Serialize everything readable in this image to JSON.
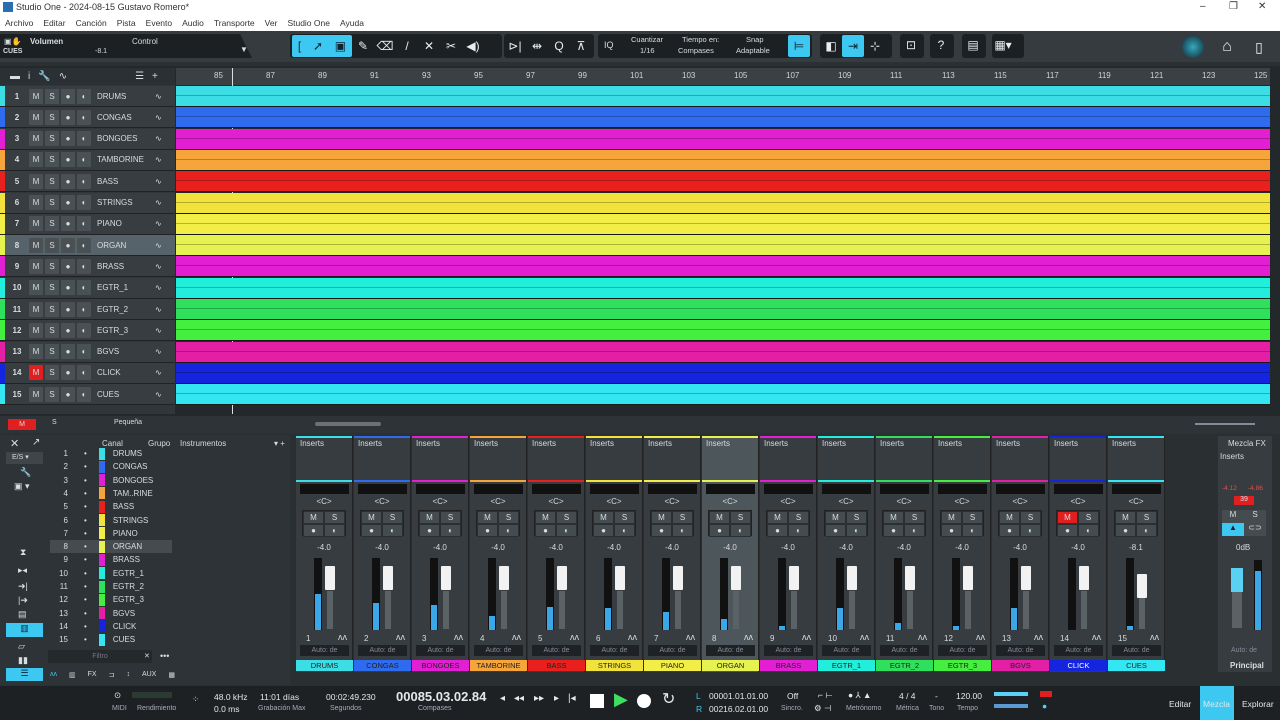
{
  "window": {
    "title": "Studio One - 2024-08-15 Gustavo Romero*",
    "minimize": "–",
    "maximize": "❐",
    "close": "✕"
  },
  "menu": [
    "Archivo",
    "Editar",
    "Canción",
    "Pista",
    "Evento",
    "Audio",
    "Transporte",
    "Ver",
    "Studio One",
    "Ayuda"
  ],
  "control_bar": {
    "param": "Volumen",
    "track": "CUES",
    "value": "-8.1",
    "control_label": "Control"
  },
  "toolbar": {
    "quantize_label": "Cuantizar",
    "quantize_value": "1/16",
    "timebase_label": "Tiempo en:",
    "timebase_value": "Compases",
    "snap_label": "Snap",
    "snap_value": "Adaptable",
    "iq": "IQ",
    "help": "?"
  },
  "ruler": [
    "85",
    "87",
    "89",
    "91",
    "93",
    "95",
    "97",
    "99",
    "101",
    "103",
    "105",
    "107",
    "109",
    "111",
    "113",
    "115",
    "117",
    "119",
    "121",
    "123",
    "125"
  ],
  "tracks": [
    {
      "n": "1",
      "name": "DRUMS",
      "color": "#3ddde6",
      "mute": false
    },
    {
      "n": "2",
      "name": "CONGAS",
      "color": "#2f6bef",
      "mute": false
    },
    {
      "n": "3",
      "name": "BONGOES",
      "color": "#e21fd3",
      "mute": false
    },
    {
      "n": "4",
      "name": "TAMBORINE",
      "color": "#f5a53a",
      "mute": false
    },
    {
      "n": "5",
      "name": "BASS",
      "color": "#e8211f",
      "mute": false
    },
    {
      "n": "6",
      "name": "STRINGS",
      "color": "#f2e23c",
      "mute": false
    },
    {
      "n": "7",
      "name": "PIANO",
      "color": "#f3ee47",
      "mute": false
    },
    {
      "n": "8",
      "name": "ORGAN",
      "color": "#e6f24f",
      "mute": false
    },
    {
      "n": "9",
      "name": "BRASS",
      "color": "#e21fd3",
      "mute": false
    },
    {
      "n": "10",
      "name": "EGTR_1",
      "color": "#22eedc",
      "mute": false
    },
    {
      "n": "11",
      "name": "EGTR_2",
      "color": "#2fe05d",
      "mute": false
    },
    {
      "n": "12",
      "name": "EGTR_3",
      "color": "#45ef3f",
      "mute": false
    },
    {
      "n": "13",
      "name": "BGVS",
      "color": "#e31fa6",
      "mute": false
    },
    {
      "n": "14",
      "name": "CLICK",
      "color": "#1424df",
      "mute": true
    },
    {
      "n": "15",
      "name": "CUES",
      "color": "#33e6f2",
      "mute": false
    }
  ],
  "track_buttons": {
    "m": "M",
    "s": "S"
  },
  "arrange_footer": {
    "m": "M",
    "s": "S",
    "size": "Pequeña"
  },
  "mixer_left": {
    "header_canal": "Canal",
    "header_grupo": "Grupo",
    "header_instr": "Instrumentos",
    "io": "E/S",
    "filter_placeholder": "Filtro",
    "tabs": [
      "FX",
      "AUX"
    ],
    "channels": [
      "DRUMS",
      "CONGAS",
      "BONGOES",
      "TAM..RINE",
      "BASS",
      "STRINGS",
      "PIANO",
      "ORGAN",
      "BRASS",
      "EGTR_1",
      "EGTR_2",
      "EGTR_3",
      "BGVS",
      "CLICK",
      "CUES"
    ]
  },
  "mixer": {
    "inserts": "Inserts",
    "pan": "<C>",
    "auto": "Auto: de",
    "channels": [
      {
        "name": "DRUMS",
        "vol": "-4.0",
        "meter": 0.5
      },
      {
        "name": "CONGAS",
        "vol": "-4.0",
        "meter": 0.38
      },
      {
        "name": "BONGOES",
        "vol": "-4.0",
        "meter": 0.35
      },
      {
        "name": "TAMBORINE",
        "vol": "-4.0",
        "meter": 0.2
      },
      {
        "name": "BASS",
        "vol": "-4.0",
        "meter": 0.32
      },
      {
        "name": "STRINGS",
        "vol": "-4.0",
        "meter": 0.3
      },
      {
        "name": "PIANO",
        "vol": "-4.0",
        "meter": 0.25
      },
      {
        "name": "ORGAN",
        "vol": "-4.0",
        "meter": 0.15
      },
      {
        "name": "BRASS",
        "vol": "-4.0",
        "meter": 0.05
      },
      {
        "name": "EGTR_1",
        "vol": "-4.0",
        "meter": 0.3
      },
      {
        "name": "EGTR_2",
        "vol": "-4.0",
        "meter": 0.1
      },
      {
        "name": "EGTR_3",
        "vol": "-4.0",
        "meter": 0.05
      },
      {
        "name": "BGVS",
        "vol": "-4.0",
        "meter": 0.3
      },
      {
        "name": "CLICK",
        "vol": "-4.0",
        "meter": 0
      },
      {
        "name": "CUES",
        "vol": "-8.1",
        "meter": 0.05
      }
    ],
    "main": {
      "fx": "Mezcla FX",
      "inserts": "Inserts",
      "peak_l": "-4.12",
      "peak_r": "-4.86",
      "clip": "39",
      "vol": "0dB",
      "auto": "Auto: de",
      "name": "Principal"
    }
  },
  "transport": {
    "midi": "MIDI",
    "perf": "Rendimiento",
    "rate": "48.0 kHz",
    "latency": "0.0 ms",
    "rec_time": "11:01 días",
    "rec_label": "Grabación Max",
    "seconds": "00:02:49.230",
    "seconds_label": "Segundos",
    "bars": "00085.03.02.84",
    "bars_label": "Compases",
    "loop_l": "00001.01.01.00",
    "loop_r": "00216.02.01.00",
    "sync": "Off",
    "sync_label": "Sincro.",
    "metro_label": "Metrónomo",
    "sig": "4 / 4",
    "sig_label": "Métrica",
    "key": "-",
    "key_label": "Tono",
    "tempo": "120.00",
    "tempo_label": "Tempo",
    "l": "L",
    "r": "R"
  },
  "views": {
    "edit": "Editar",
    "mix": "Mezcla",
    "browse": "Explorar"
  },
  "colors": {
    "accent": "#3cc8f0",
    "mute": "#e02020"
  }
}
